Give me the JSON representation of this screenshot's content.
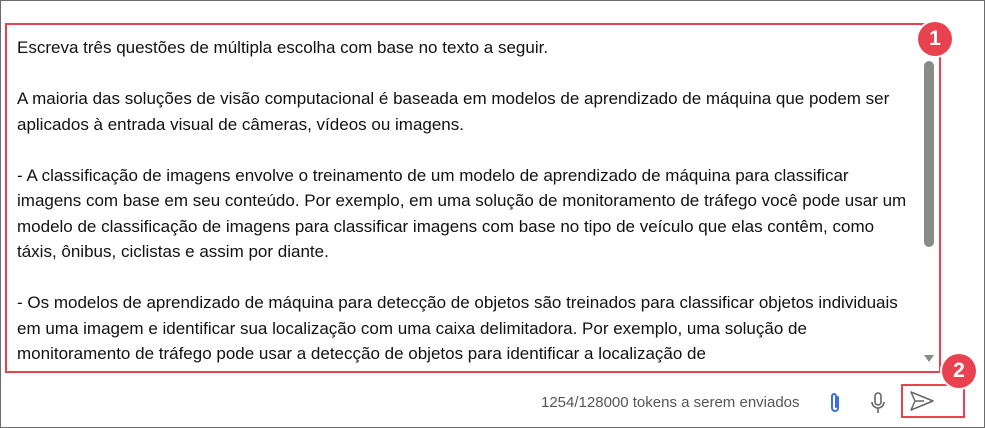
{
  "prompt": {
    "paragraphs": [
      "Escreva três questões de múltipla escolha com base no texto a seguir.",
      "A maioria das soluções de visão computacional é baseada em modelos de aprendizado de máquina que podem ser aplicados à entrada visual de câmeras, vídeos ou imagens.",
      "- A classificação de imagens envolve o treinamento de um modelo de aprendizado de máquina para classificar imagens com base em seu conteúdo. Por exemplo, em uma solução de monitoramento de tráfego você pode usar um modelo de classificação de imagens para classificar imagens com base no tipo de veículo que elas contêm, como táxis, ônibus, ciclistas e assim por diante.",
      "- Os modelos de aprendizado de máquina para detecção de objetos são treinados para classificar objetos individuais em uma imagem e identificar sua localização com uma caixa delimitadora. Por exemplo, uma solução de monitoramento de tráfego pode usar a detecção de objetos para identificar a localização de"
    ]
  },
  "footer": {
    "token_count": "1254/128000 tokens a serem enviados"
  },
  "badges": {
    "one": "1",
    "two": "2"
  },
  "icons": {
    "attach": "paperclip-icon",
    "mic": "microphone-icon",
    "send": "send-icon"
  },
  "colors": {
    "highlight": "#e8414f",
    "attach_icon": "#3a6fd8",
    "icon_gray": "#666666"
  }
}
